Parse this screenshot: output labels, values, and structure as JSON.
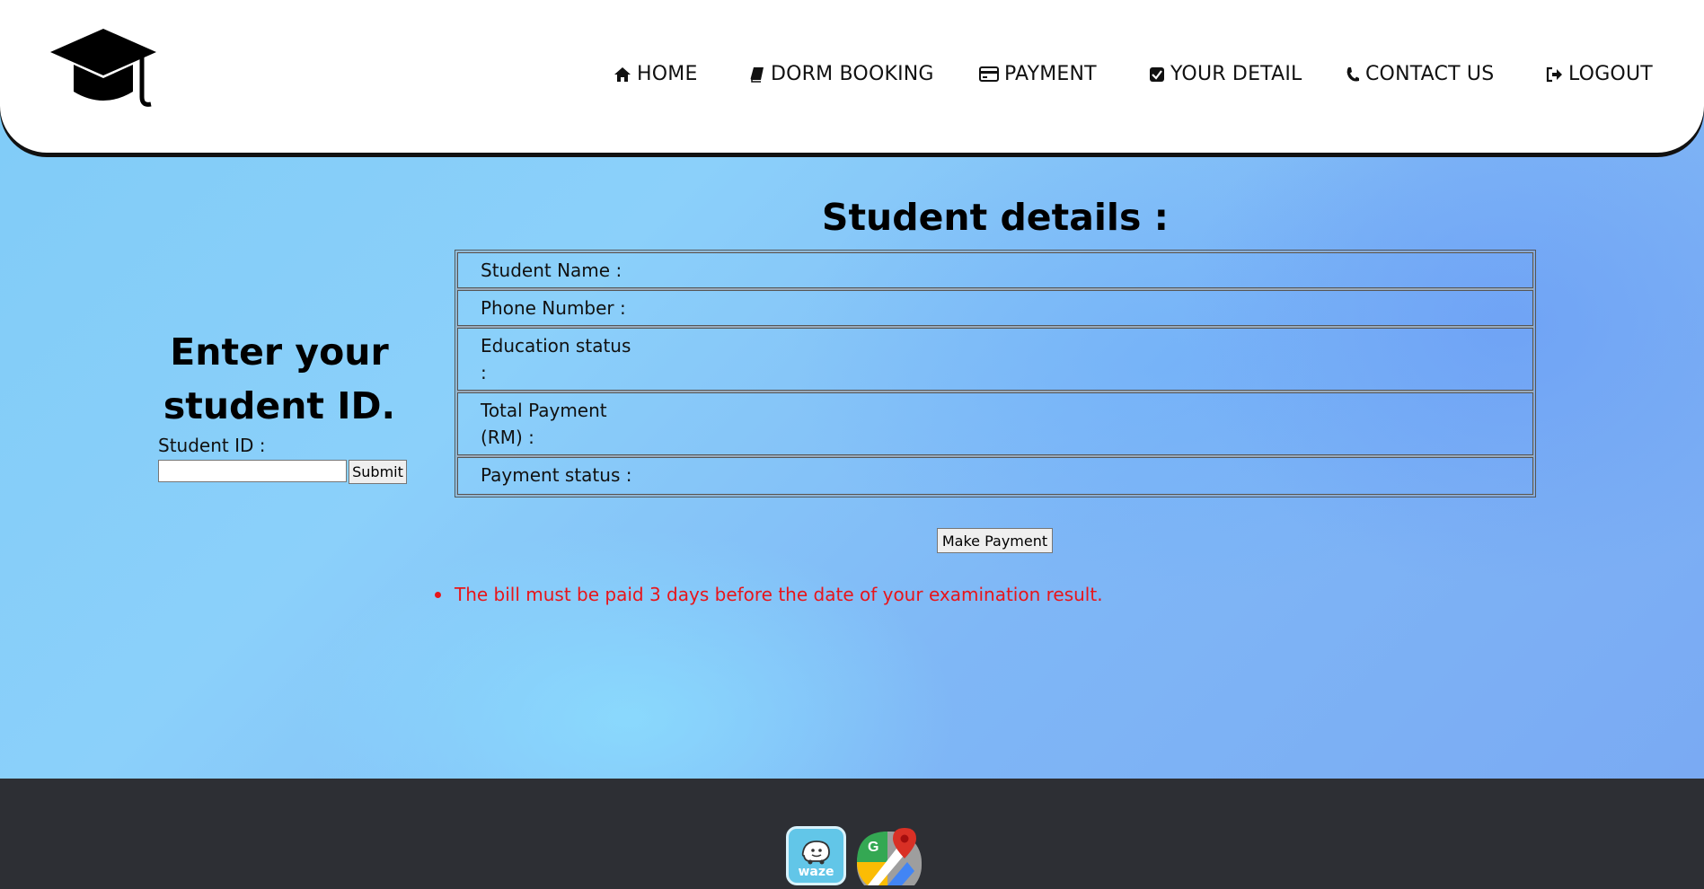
{
  "nav": {
    "items": [
      {
        "label": "HOME",
        "icon": "home-icon"
      },
      {
        "label": "DORM BOOKING",
        "icon": "book-icon"
      },
      {
        "label": "PAYMENT",
        "icon": "credit-card-icon"
      },
      {
        "label": "YOUR DETAIL",
        "icon": "check-square-icon"
      },
      {
        "label": "CONTACT US",
        "icon": "phone-icon"
      },
      {
        "label": "LOGOUT",
        "icon": "sign-out-icon"
      }
    ]
  },
  "lookup": {
    "title": "Enter your student ID.",
    "student_id_label": "Student ID :",
    "student_id_value": "",
    "submit_label": "Submit"
  },
  "details": {
    "title": "Student details :",
    "rows": [
      {
        "label": "Student Name :",
        "value": ""
      },
      {
        "label": "Phone Number :",
        "value": ""
      },
      {
        "label": "Education status :",
        "value": ""
      },
      {
        "label": "Total Payment (RM) :",
        "value": ""
      },
      {
        "label": "Payment status :",
        "value": ""
      }
    ],
    "make_payment_label": "Make Payment"
  },
  "notice": "The bill must be paid 3 days before the date of your examination result.",
  "footer": {
    "waze_label": "waze",
    "maps_icon": "google-maps-icon"
  },
  "colors": {
    "notice": "#e8151a",
    "footer_bg": "#2d2f34",
    "header_bg": "#ffffff"
  }
}
